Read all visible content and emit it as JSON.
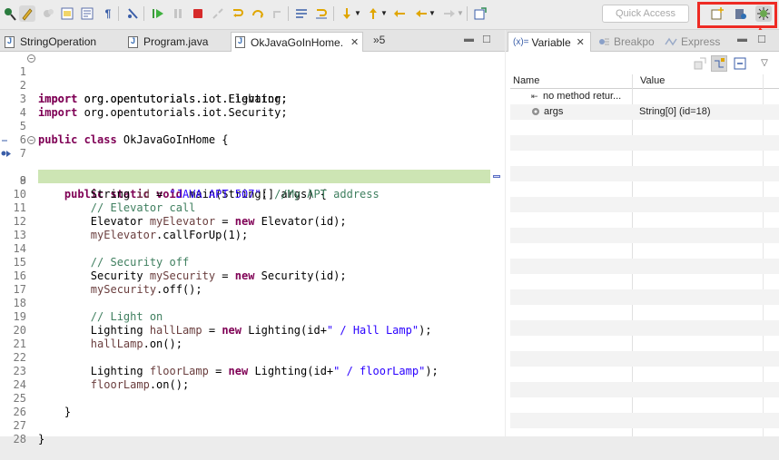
{
  "toolbar": {
    "quick_access_placeholder": "Quick Access"
  },
  "editor": {
    "tabs": [
      {
        "label": "StringOperation"
      },
      {
        "label": "Program.java"
      },
      {
        "label": "OkJavaGoInHome."
      }
    ],
    "overflow_count": "»5",
    "lines": [
      {
        "n": "1"
      },
      {
        "n": "2"
      },
      {
        "n": "3"
      },
      {
        "n": "4"
      },
      {
        "n": "5"
      },
      {
        "n": "6"
      },
      {
        "n": "7"
      },
      {
        "n": "8"
      },
      {
        "n": "9"
      },
      {
        "n": "10"
      },
      {
        "n": "11"
      },
      {
        "n": "12"
      },
      {
        "n": "13"
      },
      {
        "n": "14"
      },
      {
        "n": "15"
      },
      {
        "n": "16"
      },
      {
        "n": "17"
      },
      {
        "n": "18"
      },
      {
        "n": "19"
      },
      {
        "n": "20"
      },
      {
        "n": "21"
      },
      {
        "n": "22"
      },
      {
        "n": "23"
      },
      {
        "n": "24"
      },
      {
        "n": "25"
      },
      {
        "n": "26"
      },
      {
        "n": "27"
      },
      {
        "n": "28"
      }
    ],
    "code": {
      "l1_kw": "import",
      "l1_rest": " org.opentutorials.iot.Elevator;",
      "l2_kw": "import",
      "l2_rest": " org.opentutorials.iot.Lighting;",
      "l3_kw": "import",
      "l3_rest": " org.opentutorials.iot.Security;",
      "l5_kw": "public class",
      "l5_rest": " OkJavaGoInHome {",
      "l7_kw": "public static void",
      "l7_rest": " main(String[] args) {",
      "l8_a": "String ",
      "l8_var": "id",
      "l8_b": " = ",
      "l8_str": "\"JAVA APT 507\"",
      "l8_c": "; ",
      "l8_cm": "//My APT address",
      "l10_cm": "// Elevator call",
      "l11_a": "Elevator ",
      "l11_var": "myElevator",
      "l11_b": " = ",
      "l11_kw": "new",
      "l11_c": " Elevator(id);",
      "l12_var": "myElevator",
      "l12_rest": ".callForUp(1);",
      "l14_cm": "// Security off",
      "l15_a": "Security ",
      "l15_var": "mySecurity",
      "l15_b": " = ",
      "l15_kw": "new",
      "l15_c": " Security(id);",
      "l16_var": "mySecurity",
      "l16_rest": ".off();",
      "l18_cm": "// Light on",
      "l19_a": "Lighting ",
      "l19_var": "hallLamp",
      "l19_b": " = ",
      "l19_kw": "new",
      "l19_c": " Lighting(id+",
      "l19_str": "\" / Hall Lamp\"",
      "l19_d": ");",
      "l20_var": "hallLamp",
      "l20_rest": ".on();",
      "l22_a": "Lighting ",
      "l22_var": "floorLamp",
      "l22_b": " = ",
      "l22_kw": "new",
      "l22_c": " Lighting(id+",
      "l22_str": "\" / floorLamp\"",
      "l22_d": ");",
      "l23_var": "floorLamp",
      "l23_rest": ".on();",
      "l25": "}",
      "l27": "}"
    }
  },
  "variables": {
    "tabs": [
      {
        "prefix": "(x)=",
        "label": "Variable"
      },
      {
        "label": "Breakpo"
      },
      {
        "label": "Express"
      }
    ],
    "columns": {
      "name": "Name",
      "value": "Value"
    },
    "rows": [
      {
        "name": "no method retur...",
        "value": ""
      },
      {
        "name": "args",
        "value": "String[0]  (id=18)"
      }
    ]
  },
  "colors": {
    "highlight": "#cde5b4",
    "keyword": "#7f0055",
    "string": "#2a00ff",
    "comment": "#3f7f5f",
    "annotation_box": "#ee2b24"
  }
}
